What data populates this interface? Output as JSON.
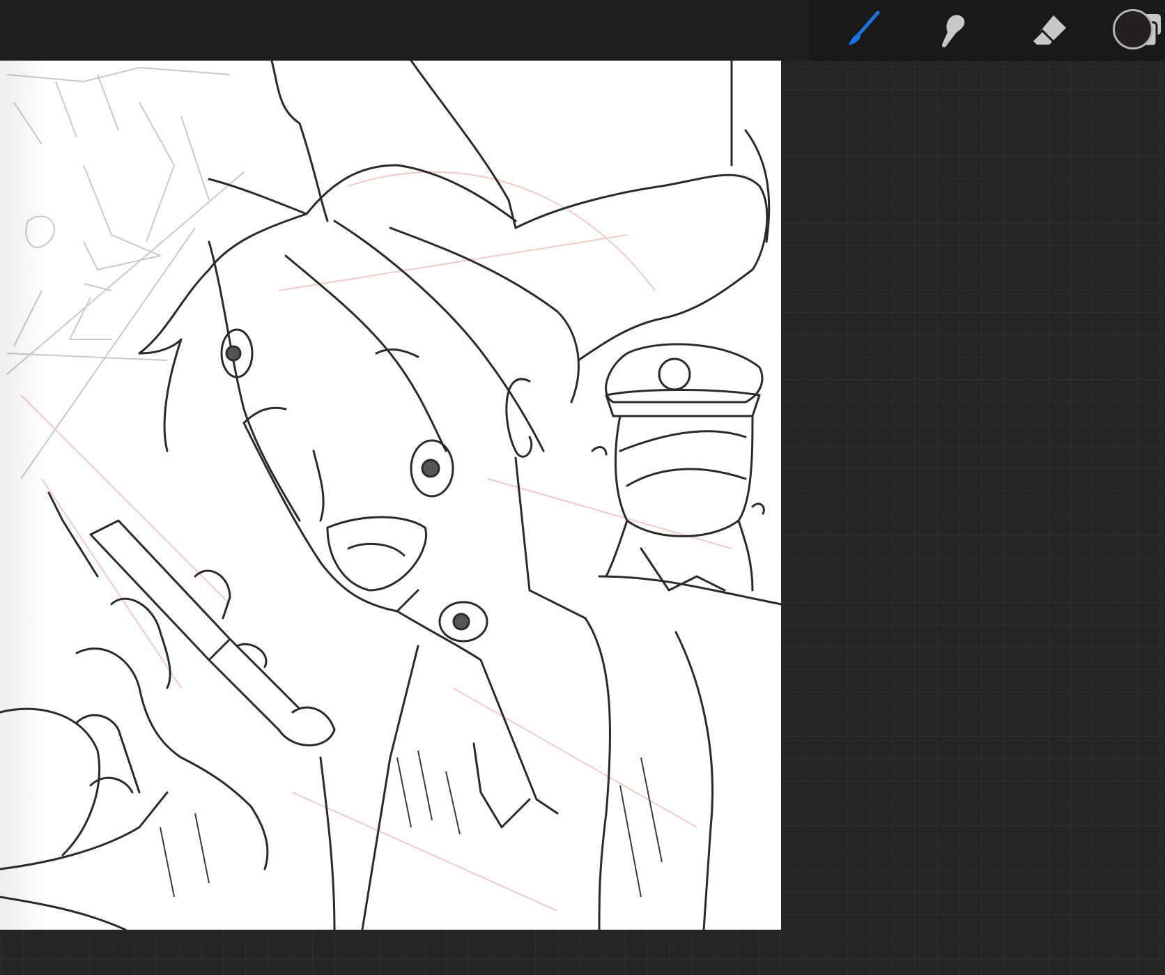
{
  "app": {
    "colors": {
      "toolbar_bg": "#1f1f1f",
      "toolbar_right_bg": "#191919",
      "workspace_bg": "#252525",
      "active_tool": "#1a73e8",
      "inactive_tool": "#c8c8c8",
      "current_color": "#261f1f"
    }
  },
  "toolbar": {
    "tools": [
      {
        "id": "brush",
        "icon": "brush-icon",
        "active": true
      },
      {
        "id": "smudge",
        "icon": "smudge-icon",
        "active": false
      },
      {
        "id": "eraser",
        "icon": "eraser-icon",
        "active": false
      },
      {
        "id": "layers",
        "icon": "layers-icon",
        "active": false
      }
    ],
    "color_well": {
      "icon": "color-swatch",
      "value": "#261f1f"
    }
  },
  "canvas": {
    "content": "line-art-sketch"
  }
}
